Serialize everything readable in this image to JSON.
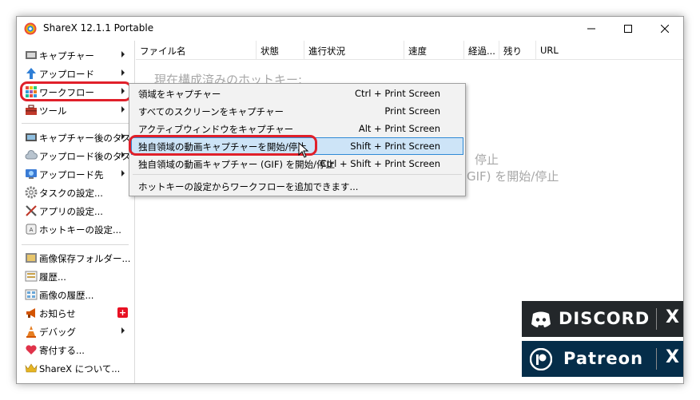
{
  "window": {
    "title": "ShareX 12.1.1 Portable"
  },
  "sidebar": {
    "items": [
      {
        "label": "キャプチャー",
        "icon": "capture-icon",
        "submenu": true
      },
      {
        "label": "アップロード",
        "icon": "upload-arrow-icon",
        "submenu": true
      },
      {
        "label": "ワークフロー",
        "icon": "workflow-grid-icon",
        "submenu": true
      },
      {
        "label": "ツール",
        "icon": "toolbox-icon",
        "submenu": true
      },
      {
        "label": "キャプチャー後のタスク",
        "icon": "after-capture-icon",
        "submenu": true
      },
      {
        "label": "アップロード後のタスク",
        "icon": "after-upload-cloud-icon",
        "submenu": true
      },
      {
        "label": "アップロード先",
        "icon": "destination-globe-icon",
        "submenu": true
      },
      {
        "label": "タスクの設定...",
        "icon": "gear-icon",
        "submenu": false
      },
      {
        "label": "アプリの設定...",
        "icon": "wrench-screwdriver-icon",
        "submenu": false
      },
      {
        "label": "ホットキーの設定...",
        "icon": "keyboard-key-icon",
        "submenu": false
      },
      {
        "label": "画像保存フォルダー...",
        "icon": "folder-icon",
        "submenu": false
      },
      {
        "label": "履歴...",
        "icon": "history-icon",
        "submenu": false
      },
      {
        "label": "画像の履歴...",
        "icon": "image-history-icon",
        "submenu": false
      },
      {
        "label": "お知らせ",
        "icon": "megaphone-icon",
        "submenu": false,
        "badge": "+"
      },
      {
        "label": "デバッグ",
        "icon": "traffic-cone-icon",
        "submenu": true
      },
      {
        "label": "寄付する...",
        "icon": "heart-icon",
        "submenu": false
      },
      {
        "label": "ShareX について...",
        "icon": "crown-icon",
        "submenu": false
      }
    ]
  },
  "list": {
    "columns": [
      "ファイル名",
      "状態",
      "進行状況",
      "速度",
      "経過...",
      "残り",
      "URL"
    ],
    "background_text_1": "現在構成済みのホットキー:",
    "background_text_2": "停止",
    "background_text_3": "GIF) を開始/停止"
  },
  "workflow_menu": {
    "items": [
      {
        "label": "領域をキャプチャー",
        "hotkey": "Ctrl + Print Screen"
      },
      {
        "label": "すべてのスクリーンをキャプチャー",
        "hotkey": "Print Screen"
      },
      {
        "label": "アクティブウィンドウをキャプチャー",
        "hotkey": "Alt + Print Screen"
      },
      {
        "label": "独自領域の動画キャプチャーを開始/停止",
        "hotkey": "Shift + Print Screen"
      },
      {
        "label": "独自領域の動画キャプチャー (GIF) を開始/停止",
        "hotkey": "Ctrl + Shift + Print Screen"
      }
    ],
    "footer": "ホットキーの設定からワークフローを追加できます..."
  },
  "promo": {
    "discord": {
      "label": "DISCORD",
      "close": "X"
    },
    "patreon": {
      "label": "Patreon",
      "close": "X"
    }
  },
  "colors": {
    "highlight": "#e0202a",
    "selection": "#cde4f7",
    "discord_bg": "#23272a",
    "patreon_bg": "#052d49"
  }
}
